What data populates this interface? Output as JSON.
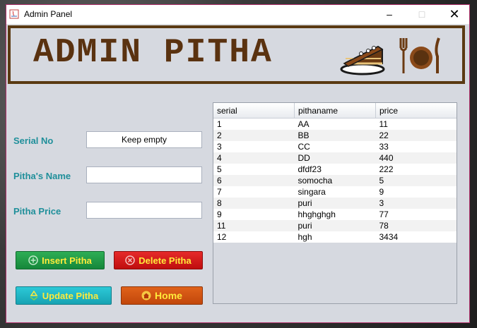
{
  "window": {
    "title": "Admin Panel",
    "minimize": "–",
    "maximize": "□",
    "close": "✕"
  },
  "banner": {
    "title": "ADMIN PITHA"
  },
  "form": {
    "serial_label": "Serial No",
    "serial_value": "Keep empty",
    "name_label": "Pitha's Name",
    "name_value": "",
    "price_label": "Pitha Price",
    "price_value": ""
  },
  "buttons": {
    "insert": "Insert Pitha",
    "delete": "Delete Pitha",
    "update": "Update Pitha",
    "home": "Home"
  },
  "table": {
    "headers": [
      "serial",
      "pithaname",
      "price"
    ],
    "rows": [
      [
        "1",
        "AA",
        "11"
      ],
      [
        "2",
        "BB",
        "22"
      ],
      [
        "3",
        "CC",
        "33"
      ],
      [
        "4",
        "DD",
        "440"
      ],
      [
        "5",
        "dfdf23",
        "222"
      ],
      [
        "6",
        "somocha",
        "5"
      ],
      [
        "7",
        "singara",
        "9"
      ],
      [
        "8",
        "puri",
        "3"
      ],
      [
        "9",
        "hhghghgh",
        "77"
      ],
      [
        "11",
        "puri",
        "78"
      ],
      [
        "12",
        "hgh",
        "3434"
      ]
    ]
  },
  "colors": {
    "accent_teal": "#1f8f9a",
    "banner_brown": "#5a3210",
    "button_text": "#ffeb3b"
  }
}
